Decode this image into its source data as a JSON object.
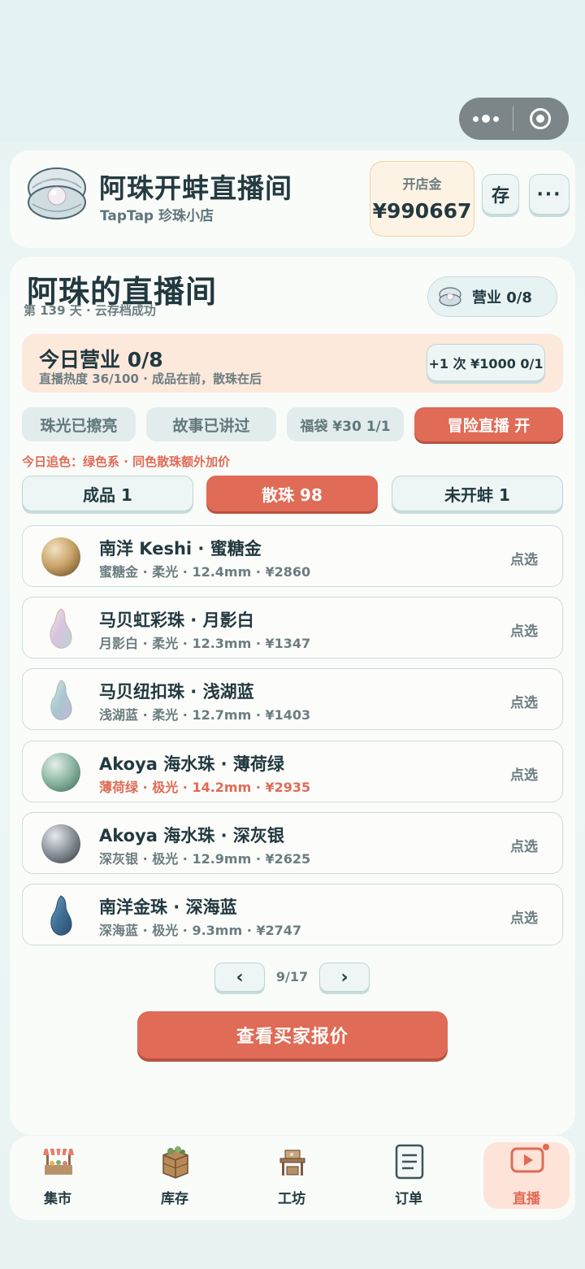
{
  "header": {
    "title": "阿珠开蚌直播间",
    "subtitle": "TapTap 珍珠小店",
    "money_label": "开店金",
    "money_value": "¥990667",
    "save_label": "存",
    "more_label": "···"
  },
  "room": {
    "title": "阿珠的直播间",
    "subtitle": "第 139 天 · 云存档成功",
    "status": "营业 0/8"
  },
  "today": {
    "title": "今日营业 0/8",
    "subtitle": "直播热度 36/100 · 成品在前，散珠在后",
    "plus_button": "+1 次 ¥1000 0/1"
  },
  "chips": [
    {
      "label": "珠光已擦亮"
    },
    {
      "label": "故事已讲过"
    },
    {
      "label": "福袋 ¥30 1/1"
    },
    {
      "label": "冒险直播 开"
    }
  ],
  "hint": "今日追色：绿色系 · 同色散珠额外加价",
  "tabs": [
    {
      "label": "成品 1"
    },
    {
      "label": "散珠 98"
    },
    {
      "label": "未开蚌 1"
    }
  ],
  "items": [
    {
      "name": "南洋 Keshi · 蜜糖金",
      "meta": "蜜糖金 · 柔光 · 12.4mm · ¥2860",
      "action": "点选",
      "color": "#c9a36a"
    },
    {
      "name": "马贝虹彩珠 · 月影白",
      "meta": "月影白 · 柔光 · 12.3mm · ¥1347",
      "action": "点选",
      "color": "#e9d9cf"
    },
    {
      "name": "马贝纽扣珠 · 浅湖蓝",
      "meta": "浅湖蓝 · 柔光 · 12.7mm · ¥1403",
      "action": "点选",
      "color": "#a9c7cf"
    },
    {
      "name": "Akoya 海水珠 · 薄荷绿",
      "meta": "薄荷绿 · 极光 · 14.2mm · ¥2935",
      "action": "点选",
      "color": "#8fb8a4"
    },
    {
      "name": "Akoya 海水珠 · 深灰银",
      "meta": "深灰银 · 极光 · 12.9mm · ¥2625",
      "action": "点选",
      "color": "#8d959c"
    },
    {
      "name": "南洋金珠 · 深海蓝",
      "meta": "深海蓝 · 极光 · 9.3mm · ¥2747",
      "action": "点选",
      "color": "#3f6f95"
    }
  ],
  "pagination": {
    "prev": "‹",
    "next": "›",
    "text": "9/17"
  },
  "quote_button": "查看买家报价",
  "nav": [
    {
      "label": "集市",
      "icon": "market-stall-icon"
    },
    {
      "label": "库存",
      "icon": "crate-icon"
    },
    {
      "label": "工坊",
      "icon": "workbench-icon"
    },
    {
      "label": "订单",
      "icon": "order-list-icon"
    },
    {
      "label": "直播",
      "icon": "live-play-icon"
    }
  ],
  "colors": {
    "accent": "#e06b56",
    "text": "#22393f",
    "muted": "#6b7d80",
    "highlight_text": "#e06b56"
  }
}
